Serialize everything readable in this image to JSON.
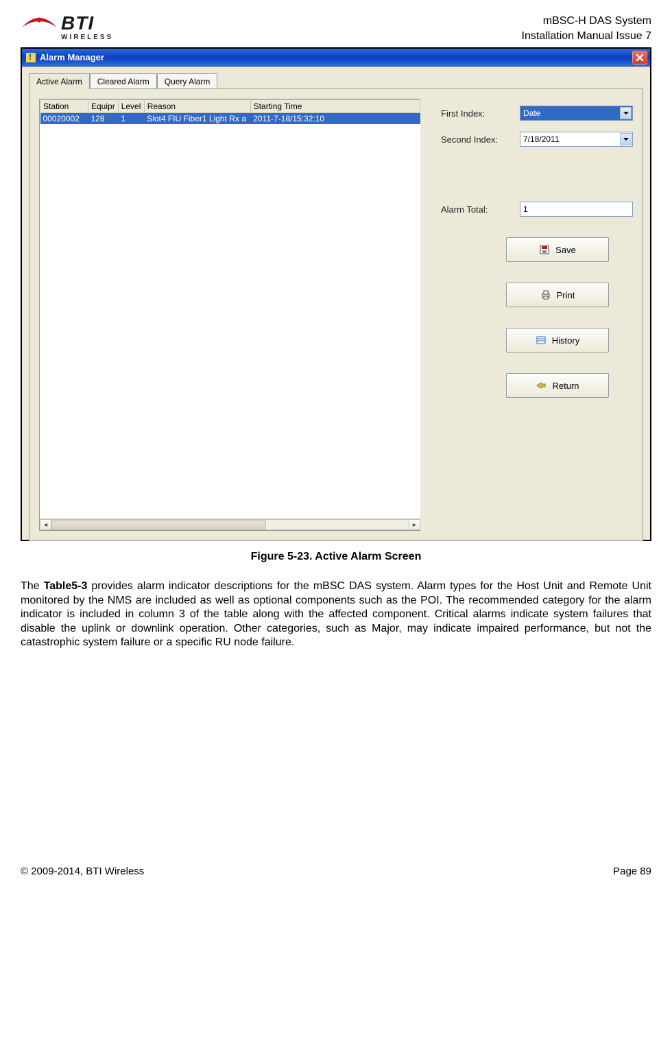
{
  "header": {
    "logo_brand": "BTI",
    "logo_sub": "WIRELESS",
    "title_line1": "mBSC-H DAS System",
    "title_line2": "Installation Manual Issue 7"
  },
  "window": {
    "title": "Alarm Manager"
  },
  "tabs": [
    {
      "label": "Active Alarm",
      "active": true
    },
    {
      "label": "Cleared Alarm",
      "active": false
    },
    {
      "label": "Query Alarm",
      "active": false
    }
  ],
  "table": {
    "headers": [
      "Station",
      "Equipr",
      "Level",
      "Reason",
      "Starting Time"
    ],
    "rows": [
      {
        "station": "00020002",
        "equip": "128",
        "level": "1",
        "reason": "Slot4 FIU Fiber1 Light Rx a",
        "time": "2011-7-18/15:32:10",
        "selected": true
      }
    ]
  },
  "controls": {
    "first_index_label": "First Index:",
    "first_index_value": "Date",
    "second_index_label": "Second Index:",
    "second_index_value": "7/18/2011",
    "alarm_total_label": "Alarm Total:",
    "alarm_total_value": "1"
  },
  "buttons": {
    "save": "Save",
    "print": "Print",
    "history": "History",
    "return": "Return"
  },
  "figure_caption": "Figure 5-23. Active Alarm Screen",
  "paragraph": {
    "lead": "The ",
    "bold": "Table5-3",
    "rest": " provides alarm indicator descriptions for the mBSC DAS system. Alarm types for the Host Unit and Remote Unit monitored by the NMS are included as well as optional components such as the POI. The recommended category for the alarm indicator is included in column 3 of the table along with the affected component. Critical alarms indicate system failures that disable the uplink or downlink operation. Other categories, such as Major, may indicate impaired performance, but not the catastrophic system failure or a specific RU node failure."
  },
  "footer": {
    "left": "© 2009-2014, BTI Wireless",
    "right": "Page 89"
  }
}
